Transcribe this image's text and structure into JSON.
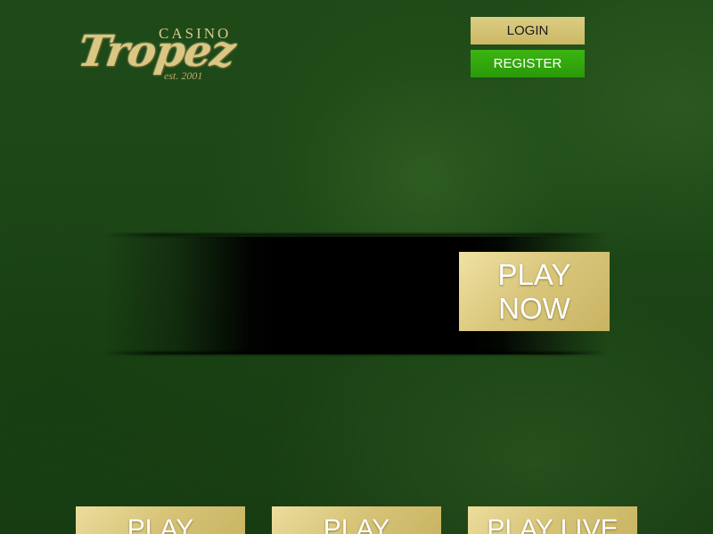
{
  "logo": {
    "casino": "CASINO",
    "tropez": "Tropez",
    "est": "est. 2001"
  },
  "header": {
    "login_label": "LOGIN",
    "register_label": "REGISTER"
  },
  "banner": {
    "play_now_line1": "PLAY",
    "play_now_line2": "NOW"
  },
  "bottom_buttons": [
    {
      "label": "PLAY"
    },
    {
      "label": "PLAY"
    },
    {
      "label": "PLAY LIVE"
    }
  ],
  "colors": {
    "background": "#1f4a18",
    "gold": "#d9c77c",
    "register_green": "#2fa80c",
    "banner_black": "#000000"
  }
}
